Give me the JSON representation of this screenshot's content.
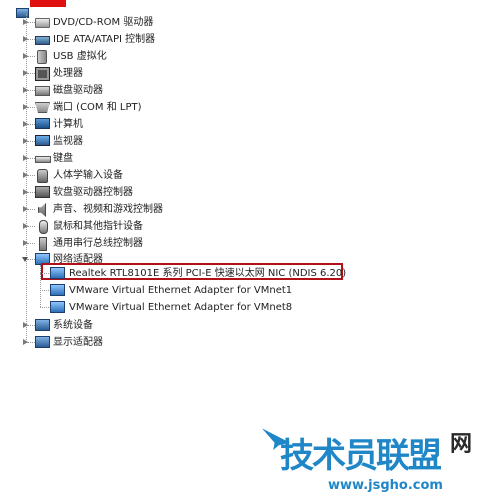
{
  "device_manager": {
    "categories": [
      {
        "label": "DVD/CD-ROM 驱动器",
        "icon": "dvd-drive-icon",
        "expanded": false
      },
      {
        "label": "IDE ATA/ATAPI 控制器",
        "icon": "ide-controller-icon",
        "expanded": false
      },
      {
        "label": "USB 虚拟化",
        "icon": "usb-icon",
        "expanded": false
      },
      {
        "label": "处理器",
        "icon": "processor-icon",
        "expanded": false
      },
      {
        "label": "磁盘驱动器",
        "icon": "disk-drive-icon",
        "expanded": false
      },
      {
        "label": "端口 (COM 和 LPT)",
        "icon": "port-icon",
        "expanded": false
      },
      {
        "label": "计算机",
        "icon": "computer-icon",
        "expanded": false
      },
      {
        "label": "监视器",
        "icon": "monitor-icon",
        "expanded": false
      },
      {
        "label": "键盘",
        "icon": "keyboard-icon",
        "expanded": false
      },
      {
        "label": "人体学输入设备",
        "icon": "hid-icon",
        "expanded": false
      },
      {
        "label": "软盘驱动器控制器",
        "icon": "floppy-controller-icon",
        "expanded": false
      },
      {
        "label": "声音、视频和游戏控制器",
        "icon": "sound-icon",
        "expanded": false
      },
      {
        "label": "鼠标和其他指针设备",
        "icon": "mouse-icon",
        "expanded": false
      },
      {
        "label": "通用串行总线控制器",
        "icon": "usb-controller-icon",
        "expanded": false
      },
      {
        "label": "网络适配器",
        "icon": "network-adapter-icon",
        "expanded": true
      },
      {
        "label": "系统设备",
        "icon": "system-device-icon",
        "expanded": false
      },
      {
        "label": "显示适配器",
        "icon": "display-adapter-icon",
        "expanded": false
      }
    ],
    "network_adapters": [
      {
        "label": "Realtek RTL8101E 系列 PCI-E 快速以太网 NIC (NDIS 6.20)",
        "highlighted": true
      },
      {
        "label": "VMware Virtual Ethernet Adapter for VMnet1",
        "highlighted": false
      },
      {
        "label": "VMware Virtual Ethernet Adapter for VMnet8",
        "highlighted": false
      }
    ]
  },
  "watermark": {
    "main": "技术员联盟",
    "net": "网",
    "url": "www.jsgho.com"
  },
  "colors": {
    "highlight_border": "#b01018",
    "watermark_blue": "#1f86c7"
  }
}
